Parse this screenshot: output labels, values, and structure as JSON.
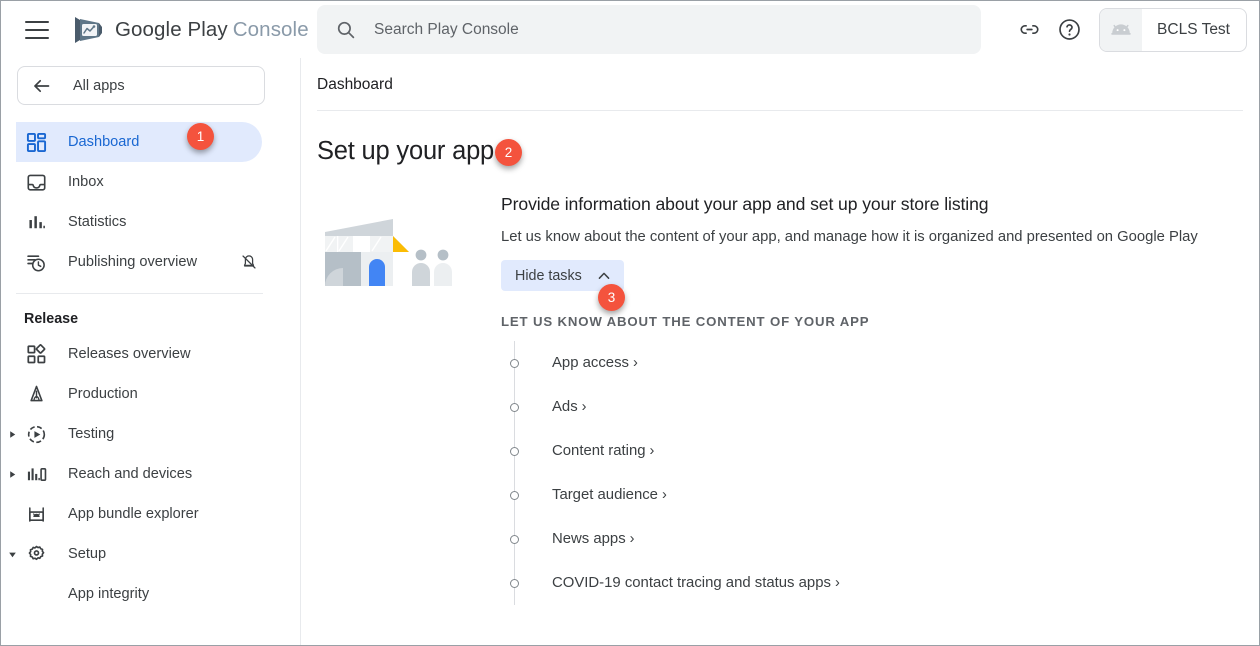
{
  "app": {
    "brand_google": "Google Play",
    "brand_console": "Console",
    "menu_icon": "hamburger-menu-icon",
    "logo_icon": "google-play-logo-icon"
  },
  "search": {
    "placeholder": "Search Play Console",
    "value": "",
    "icon": "search-icon"
  },
  "topbar": {
    "link_icon": "link-icon",
    "help_icon": "help-circle-icon",
    "account_name": "BCLS Test",
    "account_avatar_icon": "android-robot-icon"
  },
  "sidebar": {
    "all_apps": {
      "label": "All apps",
      "icon": "arrow-back-icon"
    },
    "items": [
      {
        "label": "Dashboard",
        "icon": "dashboard-grid-icon",
        "active": true
      },
      {
        "label": "Inbox",
        "icon": "inbox-tray-icon",
        "active": false
      },
      {
        "label": "Statistics",
        "icon": "bar-chart-icon",
        "active": false
      },
      {
        "label": "Publishing overview",
        "icon": "publishing-clock-icon",
        "active": false,
        "trailing_icon": "notifications-off-icon"
      }
    ],
    "section_title": "Release",
    "release_items": [
      {
        "label": "Releases overview",
        "icon": "releases-overview-icon",
        "expander": "none"
      },
      {
        "label": "Production",
        "icon": "production-rocket-icon",
        "expander": "none"
      },
      {
        "label": "Testing",
        "icon": "testing-play-circle-icon",
        "expander": "collapsed"
      },
      {
        "label": "Reach and devices",
        "icon": "reach-devices-icon",
        "expander": "collapsed"
      },
      {
        "label": "App bundle explorer",
        "icon": "app-bundle-icon",
        "expander": "none"
      },
      {
        "label": "Setup",
        "icon": "settings-gear-icon",
        "expander": "expanded"
      }
    ],
    "sub_items": [
      {
        "label": "App integrity"
      }
    ]
  },
  "main": {
    "breadcrumb": "Dashboard",
    "page_title": "Set up your app",
    "card": {
      "heading": "Provide information about your app and set up your store listing",
      "description": "Let us know about the content of your app, and manage how it is organized and presented on Google Play",
      "hide_tasks_label": "Hide tasks",
      "hide_tasks_chevron": "chevron-up-icon",
      "tasks_section_label": "LET US KNOW ABOUT THE CONTENT OF YOUR APP",
      "tasks": [
        {
          "label": "App access",
          "chevron": "›"
        },
        {
          "label": "Ads",
          "chevron": "›"
        },
        {
          "label": "Content rating",
          "chevron": "›"
        },
        {
          "label": "Target audience",
          "chevron": "›"
        },
        {
          "label": "News apps",
          "chevron": "›"
        },
        {
          "label": "COVID-19 contact tracing and status apps",
          "chevron": "›"
        }
      ]
    },
    "illustration_icon": "storefront-illustration"
  },
  "annotations": [
    {
      "number": "1",
      "target": "sidebar-item-dashboard"
    },
    {
      "number": "2",
      "target": "page-title"
    },
    {
      "number": "3",
      "target": "hide-tasks-button"
    }
  ],
  "colors": {
    "accent_blue": "#1967d2",
    "active_pill": "#e1eafd",
    "badge_red": "#f4533d",
    "text_primary": "#202124",
    "text_secondary": "#3c4043",
    "text_muted": "#5f6368",
    "border": "#dadce0"
  }
}
